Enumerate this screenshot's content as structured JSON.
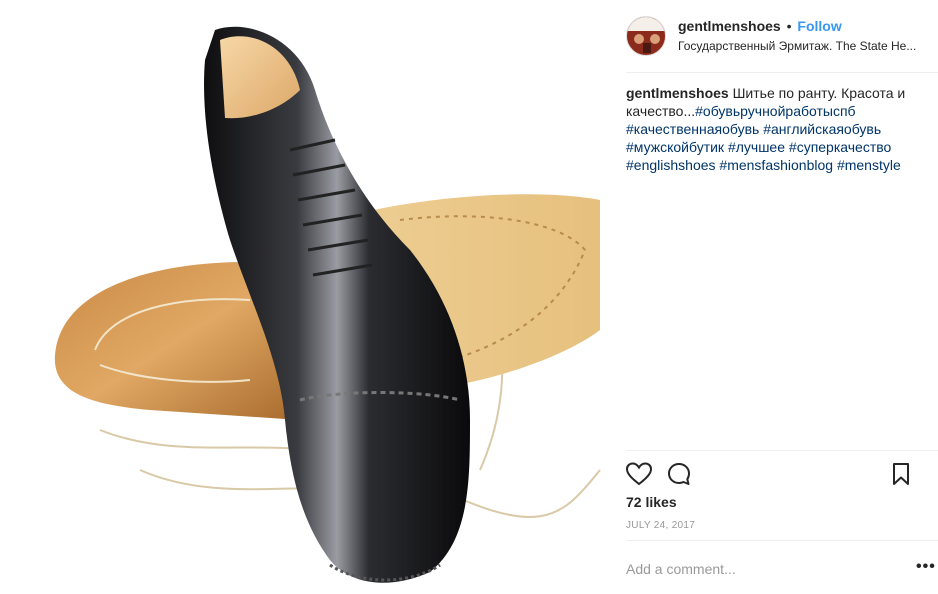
{
  "post": {
    "username": "gentlmenshoes",
    "separator": "•",
    "follow_label": "Follow",
    "location": "Государственный Эрмитаж. The State He...",
    "caption_text": " Шитье по ранту. Красота и качество...",
    "hashtags": [
      "#обувьручнойработыспб",
      "#качественнаяобувь",
      "#английскаяобувь",
      "#мужскойбутик",
      "#лучшее",
      "#суперкачество",
      "#englishshoes",
      "#mensfashionblog",
      "#menstyle"
    ],
    "likes": "72 likes",
    "date": "JULY 24, 2017",
    "comment_placeholder": "Add a comment...",
    "more_label": "•••"
  },
  "icons": {
    "like": "heart-icon",
    "comment": "comment-icon",
    "save": "bookmark-icon"
  },
  "colors": {
    "follow": "#3897f0",
    "hashtag": "#003569",
    "muted": "#999999",
    "text": "#262626"
  }
}
